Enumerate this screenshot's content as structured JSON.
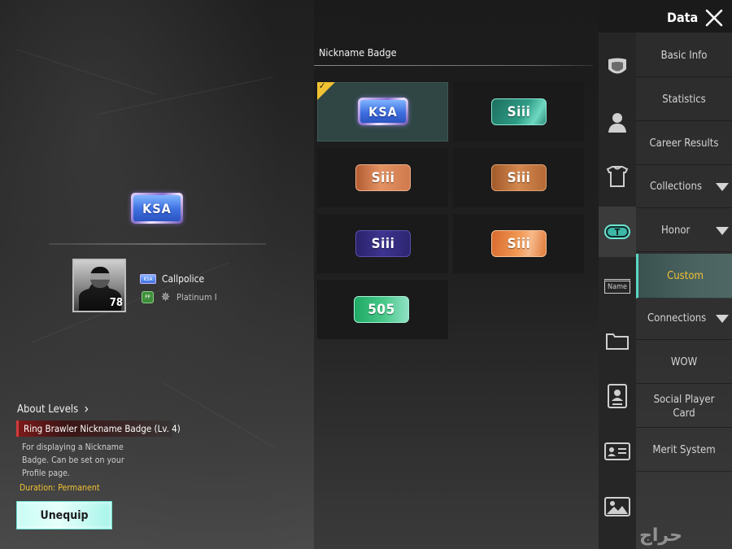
{
  "header": {
    "title": "Data"
  },
  "preview": {
    "badge_text": "KSA",
    "mini_badge_text": "KSA",
    "player_name": "Callpolice",
    "player_level": "78",
    "rank_icon_text": "PP",
    "rank_name": "Platinum I"
  },
  "details": {
    "about_levels": "About Levels",
    "item_title": "Ring Brawler Nickname Badge (Lv. 4)",
    "description": "For displaying a Nickname Badge. Can be set on your Profile page.",
    "duration": "Duration: Permanent",
    "unequip_label": "Unequip"
  },
  "grid": {
    "section_title": "Nickname Badge",
    "items": [
      {
        "label": "KSA",
        "selected": true
      },
      {
        "label": "Siii",
        "selected": false
      },
      {
        "label": "Siii",
        "selected": false
      },
      {
        "label": "Siii",
        "selected": false
      },
      {
        "label": "Siii",
        "selected": false
      },
      {
        "label": "Siii",
        "selected": false
      },
      {
        "label": "505",
        "selected": false
      }
    ]
  },
  "nav": {
    "menu": [
      {
        "label": "Basic Info"
      },
      {
        "label": "Statistics"
      },
      {
        "label": "Career Results"
      },
      {
        "label": "Collections"
      },
      {
        "label": "Honor"
      },
      {
        "label": "Custom"
      },
      {
        "label": "Connections"
      },
      {
        "label": "WOW"
      },
      {
        "label": "Social Player Card"
      },
      {
        "label": "Merit System"
      }
    ],
    "rail_icons": [
      "shield-icon",
      "person-icon",
      "wardrobe-icon",
      "title-badge-icon",
      "name-tag-icon",
      "folder-icon",
      "player-card-icon",
      "id-card-icon",
      "picture-frame-icon"
    ],
    "name_icon_text": "Name",
    "title_icon_text": "T"
  },
  "colors": {
    "accent_teal": "#5ed6c3",
    "accent_gold": "#f1c232",
    "title_bar_red": "#7b1a1a"
  },
  "watermark": {
    "text": "حراج"
  }
}
